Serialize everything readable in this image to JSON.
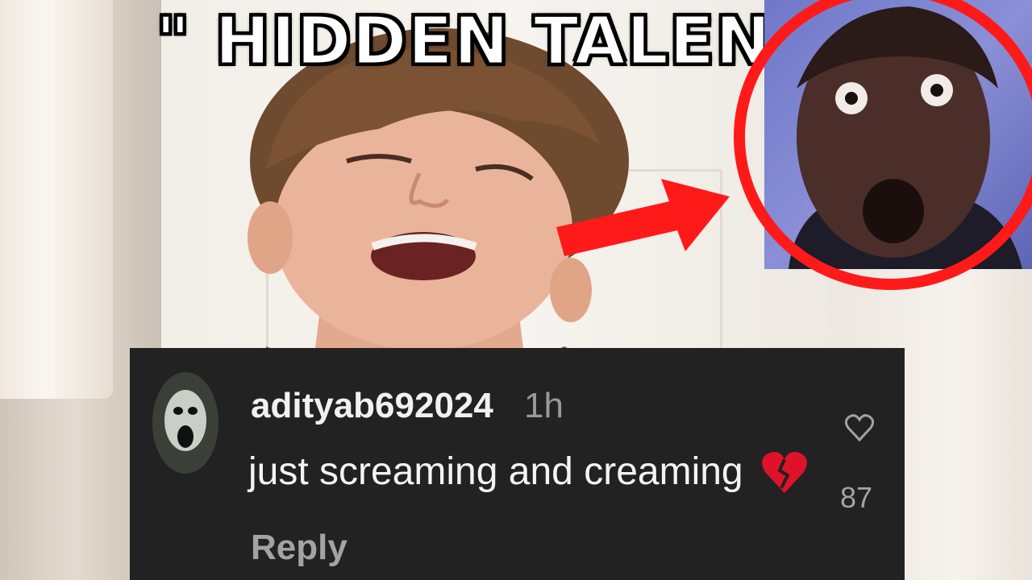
{
  "thumbnail": {
    "title": "\" HIDDEN TALENT \""
  },
  "comment": {
    "username": "adityab692024",
    "timestamp": "1h",
    "text": "just screaming and creaming",
    "emoji": "broken-heart-icon",
    "reply_label": "Reply",
    "like_count": "87",
    "like_icon": "heart-outline-icon"
  },
  "colors": {
    "title_text": "#ffffff",
    "title_outline": "#000000",
    "highlight_red": "#ff1a1a",
    "comment_bg": "#222222",
    "username_text": "#f1f1f1",
    "muted_text": "#9a9a9a"
  }
}
